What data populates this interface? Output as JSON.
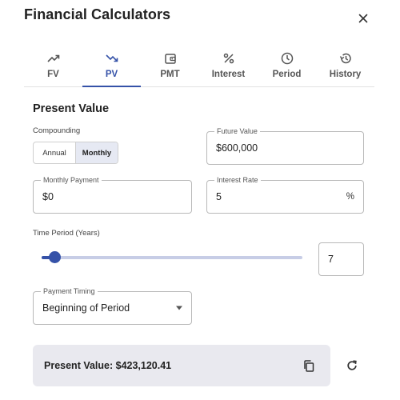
{
  "dialog": {
    "title": "Financial Calculators",
    "close_icon": "close-icon"
  },
  "tabs": [
    {
      "label": "FV",
      "icon": "trending-up-icon",
      "active": false
    },
    {
      "label": "PV",
      "icon": "trending-down-icon",
      "active": true
    },
    {
      "label": "PMT",
      "icon": "wallet-icon",
      "active": false
    },
    {
      "label": "Interest",
      "icon": "percent-icon",
      "active": false
    },
    {
      "label": "Period",
      "icon": "clock-icon",
      "active": false
    },
    {
      "label": "History",
      "icon": "history-icon",
      "active": false
    }
  ],
  "form": {
    "section_title": "Present Value",
    "compounding": {
      "label": "Compounding",
      "options": [
        "Annual",
        "Monthly"
      ],
      "selected": "Monthly"
    },
    "future_value": {
      "label": "Future Value",
      "value": "$600,000"
    },
    "monthly_payment": {
      "label": "Monthly Payment",
      "value": "$0"
    },
    "interest_rate": {
      "label": "Interest Rate",
      "value": "5",
      "suffix": "%"
    },
    "time_period": {
      "label": "Time Period (Years)",
      "value": "7",
      "slider_fraction": 0.05
    },
    "payment_timing": {
      "label": "Payment Timing",
      "value": "Beginning of Period"
    }
  },
  "result": {
    "text": "Present Value: $423,120.41",
    "copy_icon": "copy-icon",
    "refresh_icon": "refresh-icon"
  },
  "colors": {
    "accent": "#3552a8",
    "result_bg": "#e9e9ef",
    "segment_selected": "#e6e9f3"
  }
}
